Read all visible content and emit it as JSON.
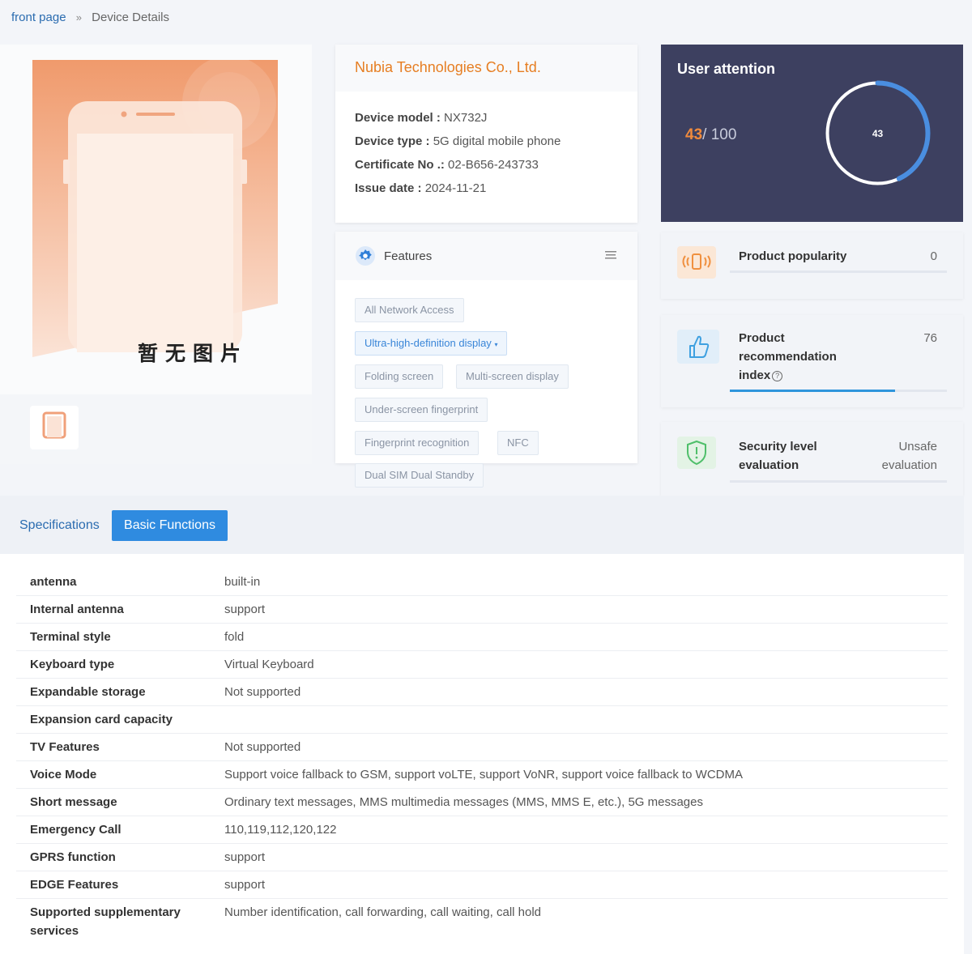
{
  "breadcrumb": {
    "home": "front page",
    "sep": "»",
    "current": "Device Details"
  },
  "image_placeholder": "暂无图片",
  "company": {
    "name": "Nubia Technologies Co., Ltd."
  },
  "device_info": [
    {
      "label": "Device model :",
      "value": "NX732J"
    },
    {
      "label": "Device type :",
      "value": "5G digital mobile phone"
    },
    {
      "label": "Certificate No .:",
      "value": "02-B656-243733"
    },
    {
      "label": "Issue date :",
      "value": "2024-11-21"
    }
  ],
  "features": {
    "title": "Features",
    "tags": [
      {
        "label": "All Network Access",
        "active": false
      },
      {
        "label": "Ultra-high-definition display",
        "active": true
      },
      {
        "label": "Folding screen",
        "active": false
      },
      {
        "label": "Multi-screen display",
        "active": false
      },
      {
        "label": "Under-screen fingerprint",
        "active": false
      },
      {
        "label": "Fingerprint recognition",
        "active": false
      },
      {
        "label": "NFC",
        "active": false
      },
      {
        "label": "Dual SIM Dual Standby",
        "active": false
      }
    ]
  },
  "attention": {
    "title": "User attention",
    "score": "43",
    "max": "/ 100",
    "gauge_label": "43",
    "gauge_fraction": 0.43
  },
  "metrics": {
    "popularity": {
      "label": "Product popularity",
      "value": "0",
      "fraction": 0
    },
    "recommendation": {
      "label_line1": "Product",
      "label_line2": "recommendation",
      "label_line3": "index",
      "help": "?",
      "value": "76",
      "fraction": 0.76
    },
    "security": {
      "label_line1": "Security level",
      "label_line2": "evaluation",
      "value_line1": "Unsafe",
      "value_line2": "evaluation"
    }
  },
  "tabs": [
    {
      "label": "Specifications",
      "active": false
    },
    {
      "label": "Basic Functions",
      "active": true
    }
  ],
  "specs": [
    {
      "key": "antenna",
      "value": "built-in"
    },
    {
      "key": "Internal antenna",
      "value": "support"
    },
    {
      "key": "Terminal style",
      "value": "fold"
    },
    {
      "key": "Keyboard type",
      "value": "Virtual Keyboard"
    },
    {
      "key": "Expandable storage",
      "value": "Not supported"
    },
    {
      "key": "Expansion card capacity",
      "value": ""
    },
    {
      "key": "TV Features",
      "value": "Not supported"
    },
    {
      "key": "Voice Mode",
      "value": "Support voice fallback to GSM, support voLTE, support VoNR, support voice fallback to WCDMA"
    },
    {
      "key": "Short message",
      "value": "Ordinary text messages, MMS multimedia messages (MMS, MMS E, etc.), 5G messages"
    },
    {
      "key": "Emergency Call",
      "value": "110,119,112,120,122"
    },
    {
      "key": "GPRS function",
      "value": "support"
    },
    {
      "key": "EDGE Features",
      "value": "support"
    },
    {
      "key": "Supported supplementary services",
      "value": "Number identification, call forwarding, call waiting, call hold"
    }
  ],
  "colors": {
    "accent": "#2f8be0",
    "company": "#e67e22",
    "attention_bg": "#3d4060",
    "score": "#f08a3c"
  }
}
